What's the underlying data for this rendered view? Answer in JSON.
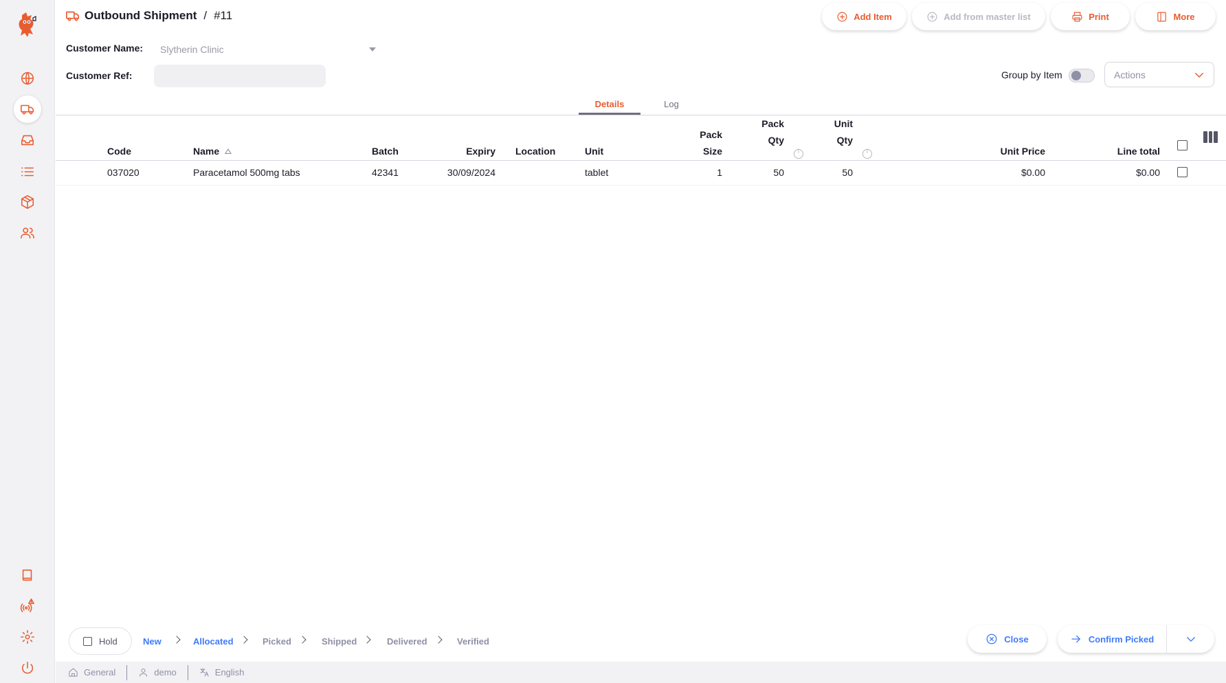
{
  "colors": {
    "brand": "#e95c30",
    "accent": "#3e7bfa",
    "muted": "#8f90a6"
  },
  "sidebar": {
    "logo": "owl-logo-icon",
    "items": [
      {
        "name": "dashboard",
        "icon": "globe-icon",
        "active": false
      },
      {
        "name": "distribution",
        "icon": "truck-icon",
        "active": true
      },
      {
        "name": "replenishment",
        "icon": "inbox-icon",
        "active": false
      },
      {
        "name": "catalogue",
        "icon": "list-icon",
        "active": false
      },
      {
        "name": "inventory",
        "icon": "box-icon",
        "active": false
      },
      {
        "name": "dispensary",
        "icon": "users-icon",
        "active": false
      }
    ],
    "bottom_items": [
      {
        "name": "docs",
        "icon": "book-icon"
      },
      {
        "name": "sync",
        "icon": "sync-alert-icon"
      },
      {
        "name": "settings",
        "icon": "gear-icon"
      },
      {
        "name": "logout",
        "icon": "power-icon"
      }
    ]
  },
  "header": {
    "title": "Outbound Shipment",
    "separator": "/",
    "number": "#11",
    "buttons": {
      "add_item": "Add Item",
      "add_from_master_list": "Add from master list",
      "print": "Print",
      "more": "More"
    }
  },
  "form": {
    "customer_name_label": "Customer Name:",
    "customer_name_value": "Slytherin Clinic",
    "customer_ref_label": "Customer Ref:",
    "customer_ref_value": "",
    "group_by_item_label": "Group by Item",
    "group_by_item_on": false,
    "actions_placeholder": "Actions"
  },
  "tabs": [
    {
      "label": "Details",
      "active": true
    },
    {
      "label": "Log",
      "active": false
    }
  ],
  "table": {
    "headers": {
      "code": "Code",
      "name": "Name",
      "batch": "Batch",
      "expiry": "Expiry",
      "location": "Location",
      "unit": "Unit",
      "pack_size_1": "Pack",
      "pack_size_2": "Size",
      "pack_qty_1": "Pack",
      "pack_qty_2": "Qty",
      "unit_qty_1": "Unit",
      "unit_qty_2": "Qty",
      "unit_price": "Unit Price",
      "line_total": "Line total"
    },
    "rows": [
      {
        "code": "037020",
        "name": "Paracetamol 500mg tabs",
        "batch": "42341",
        "expiry": "30/09/2024",
        "location": "",
        "unit": "tablet",
        "pack_size": "1",
        "pack_qty": "50",
        "unit_qty": "50",
        "unit_price": "$0.00",
        "line_total": "$0.00"
      }
    ]
  },
  "footer": {
    "hold_label": "Hold",
    "steps": [
      {
        "label": "New",
        "done": true
      },
      {
        "label": "Allocated",
        "done": true
      },
      {
        "label": "Picked",
        "done": false
      },
      {
        "label": "Shipped",
        "done": false
      },
      {
        "label": "Delivered",
        "done": false
      },
      {
        "label": "Verified",
        "done": false
      }
    ],
    "close_label": "Close",
    "confirm_label": "Confirm Picked"
  },
  "status_bar": {
    "store": "General",
    "user": "demo",
    "language": "English"
  }
}
